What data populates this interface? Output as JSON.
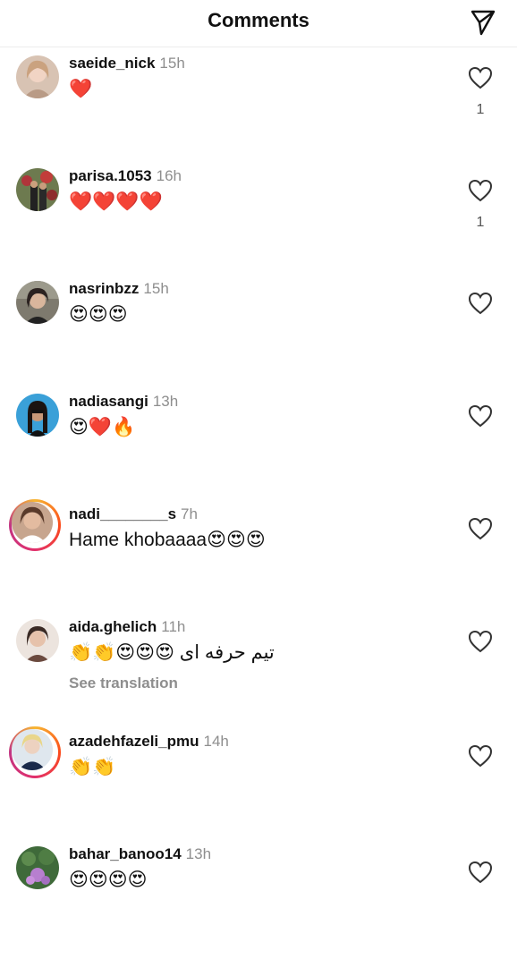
{
  "header": {
    "title": "Comments",
    "send_icon": "send-icon"
  },
  "comments": [
    {
      "user": "saeide_nick",
      "time": "15h",
      "text": "❤️",
      "likes": "1"
    },
    {
      "user": "parisa.1053",
      "time": "16h",
      "text": "❤️❤️❤️❤️",
      "likes": "1"
    },
    {
      "user": "nasrinbzz",
      "time": "15h",
      "text": "😍😍😍"
    },
    {
      "user": "nadiasangi",
      "time": "13h",
      "text": "😍❤️🔥"
    },
    {
      "user": "nadi________s",
      "time": "7h",
      "text": "Hame khobaaaa😍😍😍"
    },
    {
      "user": "aida.ghelich",
      "time": "11h",
      "text": "تیم حرفه ای 😍😍😍👏👏",
      "see_translation": "See translation"
    },
    {
      "user": "azadehfazeli_pmu",
      "time": "14h",
      "text": "👏👏"
    },
    {
      "user": "bahar_banoo14",
      "time": "13h",
      "text": "😍😍😍😍"
    }
  ],
  "icons": {
    "like": "heart-outline-icon",
    "send": "paper-plane-icon"
  },
  "colors": {
    "background": "#ffffff",
    "muted": "#8e8e8e",
    "story_ring": "#e1306c"
  }
}
